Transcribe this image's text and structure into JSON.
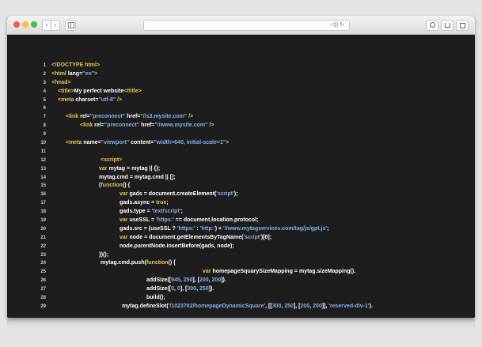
{
  "browser": {
    "nav_back": "‹",
    "nav_forward": "›",
    "url_icons": "◁)) ↻"
  },
  "colors": {
    "tag": "#e6c64a",
    "string": "#7fb3e6",
    "text": "#ffffff",
    "background": "#1d1d1d"
  },
  "code": {
    "lines": [
      {
        "n": "1",
        "indent": 0,
        "segs": [
          [
            "tag",
            "<!DOCTYPE html>"
          ]
        ]
      },
      {
        "n": "2",
        "indent": 0,
        "segs": [
          [
            "tag",
            "<html "
          ],
          [
            "attr",
            "lang="
          ],
          [
            "str",
            "\"en\""
          ],
          [
            "tag",
            ">"
          ]
        ]
      },
      {
        "n": "3",
        "indent": 0,
        "segs": [
          [
            "tag",
            "<head>"
          ]
        ]
      },
      {
        "n": "4",
        "indent": 8,
        "segs": [
          [
            "tag",
            "<title>"
          ],
          [
            "pl",
            "My perfect website"
          ],
          [
            "tag",
            "</title>"
          ]
        ]
      },
      {
        "n": "5",
        "indent": 8,
        "segs": [
          [
            "tag",
            "<meta "
          ],
          [
            "attr",
            "charset="
          ],
          [
            "str",
            "\"utf-8\""
          ],
          [
            "tag",
            " />"
          ]
        ]
      },
      {
        "n": "6",
        "indent": 0,
        "segs": []
      },
      {
        "n": "7",
        "indent": 18,
        "segs": [
          [
            "tag",
            "<link "
          ],
          [
            "attr",
            "rel="
          ],
          [
            "str",
            "\"preconnect\""
          ],
          [
            "attr",
            " href="
          ],
          [
            "str",
            "\"//s3.mysite.com\""
          ],
          [
            "tag",
            " />"
          ]
        ]
      },
      {
        "n": "8",
        "indent": 36,
        "segs": [
          [
            "tag",
            "<link "
          ],
          [
            "attr",
            "rel="
          ],
          [
            "str",
            "\"preconnect\""
          ],
          [
            "attr",
            " href="
          ],
          [
            "str",
            "\"//www.mysite.com\""
          ],
          [
            "tag",
            " />"
          ]
        ]
      },
      {
        "n": "9",
        "indent": 0,
        "segs": []
      },
      {
        "n": "10",
        "indent": 18,
        "segs": [
          [
            "tag",
            "<meta "
          ],
          [
            "attr",
            "name="
          ],
          [
            "str",
            "\"viewport\""
          ],
          [
            "attr",
            " content="
          ],
          [
            "str",
            "\"width=640, initial-scale=1\""
          ],
          [
            "tag",
            ">"
          ]
        ]
      },
      {
        "n": "11",
        "indent": 0,
        "segs": []
      },
      {
        "n": "12",
        "indent": 62,
        "segs": [
          [
            "tag",
            "<script>"
          ]
        ]
      },
      {
        "n": "13",
        "indent": 60,
        "segs": [
          [
            "kw",
            "var "
          ],
          [
            "pl",
            "mytag = mytag || {};"
          ]
        ]
      },
      {
        "n": "14",
        "indent": 60,
        "segs": [
          [
            "pl",
            "mytag.cmd = mytag.cmd || [];"
          ]
        ]
      },
      {
        "n": "15",
        "indent": 60,
        "segs": [
          [
            "pl",
            "("
          ],
          [
            "kw",
            "function"
          ],
          [
            "pl",
            "() {"
          ]
        ]
      },
      {
        "n": "16",
        "indent": 86,
        "segs": [
          [
            "kw",
            "var "
          ],
          [
            "pl",
            "gads = document.createElement("
          ],
          [
            "str",
            "'script'"
          ],
          [
            "pl",
            ");"
          ]
        ]
      },
      {
        "n": "17",
        "indent": 86,
        "segs": [
          [
            "pl",
            "gads.async = "
          ],
          [
            "kw",
            "true"
          ],
          [
            "pl",
            ";"
          ]
        ]
      },
      {
        "n": "18",
        "indent": 86,
        "segs": [
          [
            "pl",
            "gads.type = "
          ],
          [
            "str",
            "'text/script'"
          ],
          [
            "pl",
            ";"
          ]
        ]
      },
      {
        "n": "19",
        "indent": 86,
        "segs": [
          [
            "kw",
            "var "
          ],
          [
            "pl",
            "useSSL = "
          ],
          [
            "str",
            "'https:'"
          ],
          [
            "pl",
            " == document.location.protocol;"
          ]
        ]
      },
      {
        "n": "20",
        "indent": 86,
        "segs": [
          [
            "pl",
            "gads.src = (useSSL ? "
          ],
          [
            "str",
            "'https:'"
          ],
          [
            "pl",
            " : "
          ],
          [
            "str",
            "'http:'"
          ],
          [
            "pl",
            ") + "
          ],
          [
            "str",
            "'//www.mytagservices.com/tag/js/gpt.js'"
          ],
          [
            "pl",
            ";"
          ]
        ]
      },
      {
        "n": "21",
        "indent": 86,
        "segs": [
          [
            "kw",
            "var "
          ],
          [
            "pl",
            "node = document.getElementsByTagName("
          ],
          [
            "str",
            "'script'"
          ],
          [
            "pl",
            ")[0];"
          ]
        ]
      },
      {
        "n": "22",
        "indent": 86,
        "segs": [
          [
            "pl",
            "node.parentNode.insertBefore(gads, node);"
          ]
        ]
      },
      {
        "n": "23",
        "indent": 60,
        "segs": [
          [
            "pl",
            "})();"
          ]
        ]
      },
      {
        "n": "24",
        "indent": 62,
        "segs": [
          [
            "pl",
            "mytag.cmd.push("
          ],
          [
            "kw",
            "function"
          ],
          [
            "pl",
            "() {"
          ]
        ]
      },
      {
        "n": "25",
        "indent": 191,
        "segs": [
          [
            "kw",
            "var "
          ],
          [
            "pl",
            "homepageSquarySizeMapping = mytag.sizeMapping()."
          ]
        ]
      },
      {
        "n": "26",
        "indent": 120,
        "segs": [
          [
            "pl",
            "addSize(["
          ],
          [
            "num",
            "945"
          ],
          [
            "pl",
            ", "
          ],
          [
            "num",
            "250"
          ],
          [
            "pl",
            "], ["
          ],
          [
            "num",
            "200"
          ],
          [
            "pl",
            ", "
          ],
          [
            "num",
            "200"
          ],
          [
            "pl",
            "])."
          ]
        ]
      },
      {
        "n": "27",
        "indent": 120,
        "segs": [
          [
            "pl",
            "addSize(["
          ],
          [
            "num",
            "0"
          ],
          [
            "pl",
            ", "
          ],
          [
            "num",
            "0"
          ],
          [
            "pl",
            "], ["
          ],
          [
            "num",
            "300"
          ],
          [
            "pl",
            ", "
          ],
          [
            "num",
            "250"
          ],
          [
            "pl",
            "])."
          ]
        ]
      },
      {
        "n": "28",
        "indent": 120,
        "segs": [
          [
            "pl",
            "build();"
          ]
        ]
      },
      {
        "n": "29",
        "indent": 89,
        "segs": [
          [
            "pl",
            "mytag.defineSlot("
          ],
          [
            "str",
            "'/1023782/homepageDynamicSquare'"
          ],
          [
            "pl",
            ", [["
          ],
          [
            "num",
            "300"
          ],
          [
            "pl",
            ", "
          ],
          [
            "num",
            "250"
          ],
          [
            "pl",
            "], ["
          ],
          [
            "num",
            "200"
          ],
          [
            "pl",
            ", "
          ],
          [
            "num",
            "200"
          ],
          [
            "pl",
            "]], "
          ],
          [
            "str",
            "'reserved-div-1'"
          ],
          [
            "pl",
            ")."
          ]
        ]
      }
    ]
  }
}
